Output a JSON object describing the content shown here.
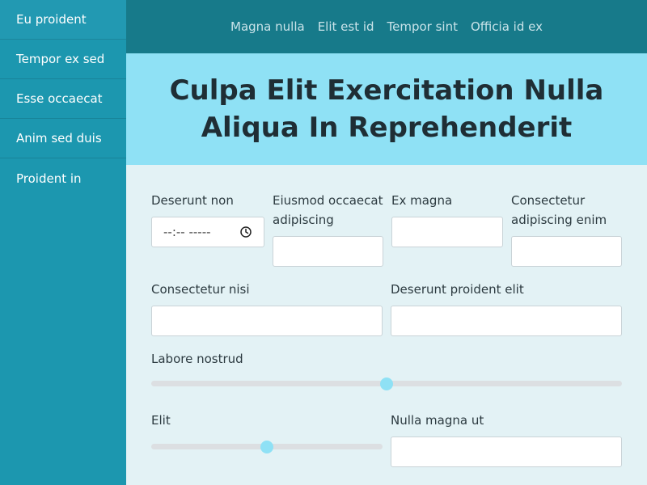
{
  "sidebar": {
    "items": [
      {
        "label": "Eu proident"
      },
      {
        "label": "Tempor ex sed"
      },
      {
        "label": "Esse occaecat"
      },
      {
        "label": "Anim sed duis"
      },
      {
        "label": "Proident in"
      }
    ]
  },
  "topnav": {
    "links": [
      {
        "label": "Magna nulla"
      },
      {
        "label": "Elit est id"
      },
      {
        "label": "Tempor sint"
      },
      {
        "label": "Officia id ex"
      }
    ]
  },
  "hero": {
    "title": "Culpa Elit Exercitation Nulla Aliqua In Reprehenderit"
  },
  "form": {
    "deserunt_non": {
      "label": "Deserunt non",
      "placeholder": "--:-- -----"
    },
    "eiusmod": {
      "label": "Eiusmod occaecat adipiscing",
      "value": ""
    },
    "ex_magna": {
      "label": "Ex magna",
      "value": ""
    },
    "consectetur_enim": {
      "label": "Consectetur adipiscing enim",
      "value": ""
    },
    "consectetur_nisi": {
      "label": "Consectetur nisi",
      "value": ""
    },
    "deserunt_proident": {
      "label": "Deserunt proident elit",
      "value": ""
    },
    "labore_nostrud": {
      "label": "Labore nostrud",
      "value": 0.5
    },
    "elit": {
      "label": "Elit",
      "value": 0.5
    },
    "nulla_magna": {
      "label": "Nulla magna ut",
      "value": ""
    }
  },
  "colors": {
    "sidebar": "#1c97af",
    "topnav": "#177a8a",
    "hero": "#8fe1f5",
    "accent": "#8fe1f5"
  },
  "icons": {
    "time": "clock-icon"
  }
}
